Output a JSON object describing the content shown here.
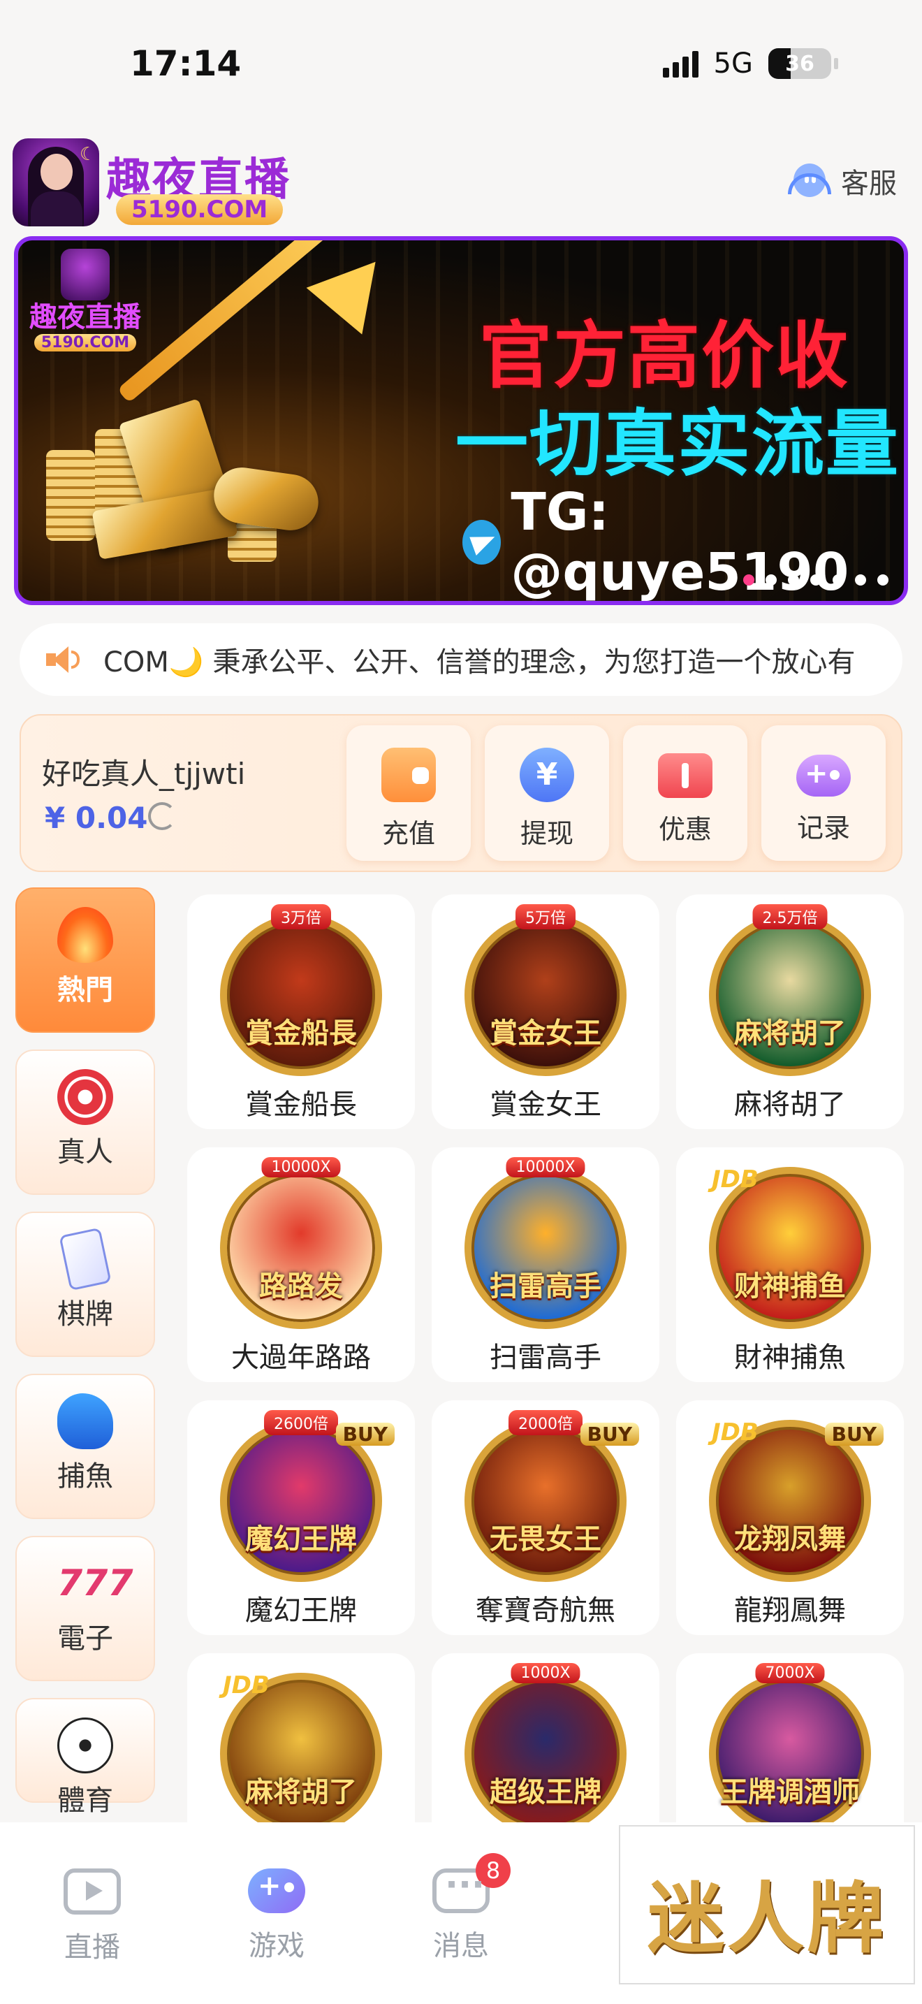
{
  "status": {
    "time": "17:14",
    "network": "5G",
    "battery": "36"
  },
  "header": {
    "brand": "趣夜直播",
    "domain": "5190.COM",
    "service_label": "客服"
  },
  "banner": {
    "logo_title": "趣夜直播",
    "logo_domain": "5190.COM",
    "line1": "官方高价收",
    "line2": "一切真实流量",
    "tg": "TG: @quye5190",
    "slides": 7,
    "active_slide": 1
  },
  "notice": {
    "text": "COM🌙 秉承公平、公开、信誉的理念，为您打造一个放心有"
  },
  "user": {
    "name": "好吃真人_tjjwti",
    "balance": "¥ 0.04",
    "actions": [
      {
        "label": "充值",
        "icon": "wallet-icon"
      },
      {
        "label": "提现",
        "icon": "yen-coin-icon"
      },
      {
        "label": "优惠",
        "icon": "coupon-icon"
      },
      {
        "label": "记录",
        "icon": "gamepad-icon"
      }
    ]
  },
  "categories": [
    {
      "label": "熱門",
      "icon": "flame-icon",
      "active": true
    },
    {
      "label": "真人",
      "icon": "casino-chip-icon",
      "active": false
    },
    {
      "label": "棋牌",
      "icon": "playing-cards-icon",
      "active": false
    },
    {
      "label": "捕魚",
      "icon": "shark-icon",
      "active": false
    },
    {
      "label": "電子",
      "icon": "slot-777-icon",
      "active": false
    },
    {
      "label": "體育",
      "icon": "soccer-ball-icon",
      "active": false
    }
  ],
  "games": [
    {
      "name": "賞金船長",
      "art_title": "賞金船長",
      "badge": "3万倍",
      "colors": [
        "#5a1a0a",
        "#c23a1a"
      ]
    },
    {
      "name": "賞金女王",
      "art_title": "賞金女王",
      "badge": "5万倍",
      "colors": [
        "#3a0f0a",
        "#b0401a"
      ]
    },
    {
      "name": "麻将胡了",
      "art_title": "麻将胡了",
      "badge": "2.5万倍",
      "colors": [
        "#0f5a2a",
        "#e8d9a0"
      ]
    },
    {
      "name": "大過年路路",
      "art_title": "路路发",
      "badge": "10000X",
      "colors": [
        "#ffe0b0",
        "#e23a2a"
      ]
    },
    {
      "name": "扫雷高手",
      "art_title": "扫雷高手",
      "badge": "10000X",
      "colors": [
        "#1a6ad8",
        "#ffb02a"
      ]
    },
    {
      "name": "財神捕魚",
      "art_title": "财神捕鱼",
      "badge": "JDB",
      "colors": [
        "#c21a1a",
        "#ffcf3a"
      ]
    },
    {
      "name": "魔幻王牌",
      "art_title": "魔幻王牌",
      "badge": "2600倍",
      "buy": "BUY",
      "colors": [
        "#4a1a8a",
        "#e23a6a"
      ]
    },
    {
      "name": "奪寶奇航無",
      "art_title": "无畏女王",
      "badge": "2000倍",
      "buy": "BUY",
      "colors": [
        "#6a1a0a",
        "#e8702a"
      ]
    },
    {
      "name": "龍翔鳳舞",
      "art_title": "龙翔凤舞",
      "badge": "JDB",
      "buy": "BUY",
      "colors": [
        "#7a0a0a",
        "#d8a02a"
      ]
    },
    {
      "name": "",
      "art_title": "麻将胡了",
      "badge": "JDB",
      "colors": [
        "#7a3a0a",
        "#f0c040"
      ]
    },
    {
      "name": "",
      "art_title": "超级王牌",
      "badge": "1000X",
      "colors": [
        "#8a1a1a",
        "#2a2a6a"
      ]
    },
    {
      "name": "",
      "art_title": "王牌调酒师",
      "badge": "7000X",
      "colors": [
        "#3a1a6a",
        "#d85aa0"
      ]
    }
  ],
  "tabbar": {
    "tabs": [
      {
        "label": "直播",
        "icon": "tv-icon"
      },
      {
        "label": "游戏",
        "icon": "gamepad-icon"
      },
      {
        "label": "消息",
        "icon": "message-icon",
        "badge": "8"
      }
    ],
    "promo": "迷人牌"
  }
}
